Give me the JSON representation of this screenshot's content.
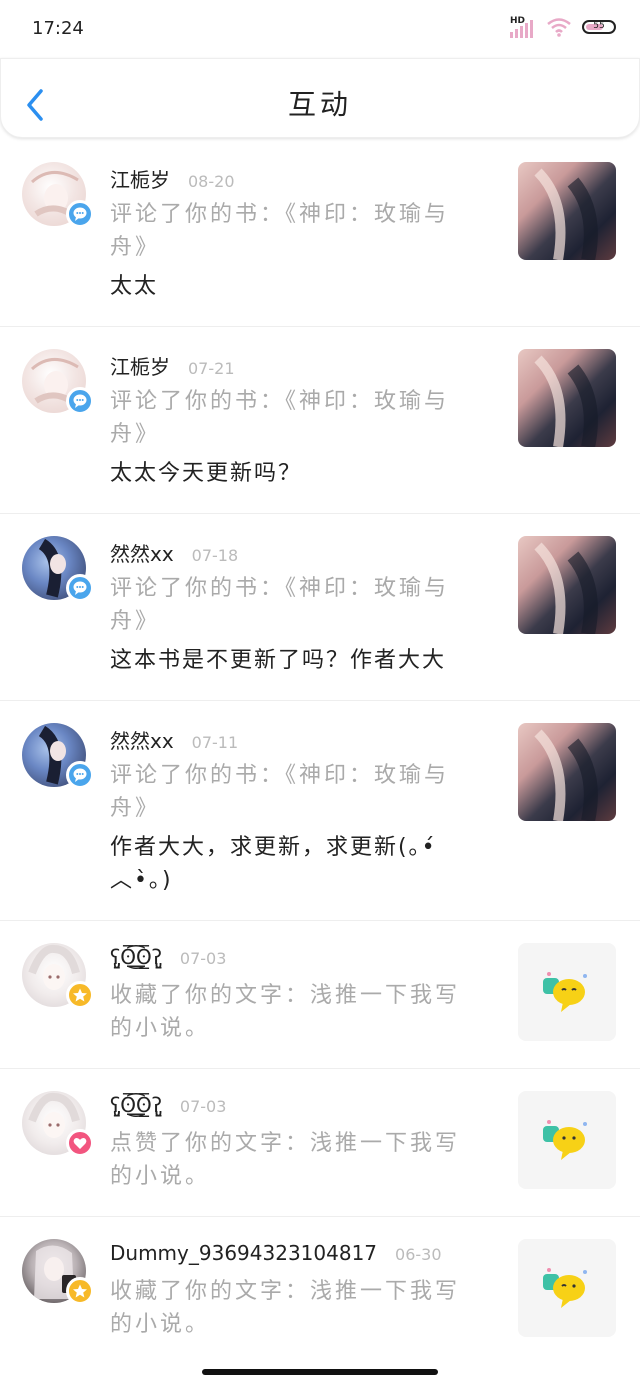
{
  "status": {
    "time": "17:24",
    "network": "HD",
    "battery": "55"
  },
  "header": {
    "title": "互动"
  },
  "colors": {
    "comment_badge": "#4aa5ec",
    "star_badge": "#f7b928",
    "like_badge": "#f2557f"
  },
  "items": [
    {
      "name": "江栀岁",
      "date": "08-20",
      "action": "评论了你的书：《神印：玫瑜与舟》",
      "message": "太太",
      "badge": "comment-icon"
    },
    {
      "name": "江栀岁",
      "date": "07-21",
      "action": "评论了你的书：《神印：玫瑜与舟》",
      "message": "太太今天更新吗？",
      "badge": "comment-icon"
    },
    {
      "name": "然然xx",
      "date": "07-18",
      "action": "评论了你的书：《神印：玫瑜与舟》",
      "message": "这本书是不更新了吗？作者大大",
      "badge": "comment-icon"
    },
    {
      "name": "然然xx",
      "date": "07-11",
      "action": "评论了你的书：《神印：玫瑜与舟》",
      "message": "作者大大，求更新，求更新(｡•́︿•̀｡)",
      "badge": "comment-icon"
    },
    {
      "name": "ʕ̡̢̡ʘ̅͟͜͡ʘ̲̅ʔ̢̡̢",
      "date": "07-03",
      "action": "收藏了你的文字：浅推一下我写的小说。",
      "message": "",
      "badge": "star-icon"
    },
    {
      "name": "ʕ̡̢̡ʘ̅͟͜͡ʘ̲̅ʔ̢̡̢",
      "date": "07-03",
      "action": "点赞了你的文字：浅推一下我写的小说。",
      "message": "",
      "badge": "heart-icon"
    },
    {
      "name": "Dummy_93694323104817",
      "date": "06-30",
      "action": "收藏了你的文字：浅推一下我写的小说。",
      "message": "",
      "badge": "star-icon"
    }
  ]
}
